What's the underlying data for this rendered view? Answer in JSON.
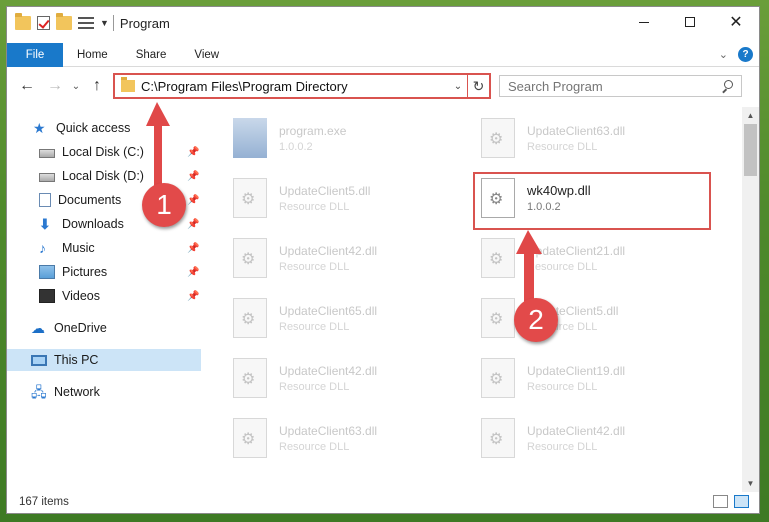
{
  "window": {
    "title": "Program",
    "status": "167 items"
  },
  "ribbon": {
    "tabs": [
      "File",
      "Home",
      "Share",
      "View"
    ]
  },
  "address": {
    "path": "C:\\Program Files\\Program Directory"
  },
  "search": {
    "placeholder": "Search Program"
  },
  "sidebar": {
    "items": [
      {
        "label": "Quick access",
        "icon": "star-icon"
      },
      {
        "label": "Local Disk (C:)",
        "icon": "drive-icon"
      },
      {
        "label": "Local Disk (D:)",
        "icon": "drive-icon"
      },
      {
        "label": "Documents",
        "icon": "documents-icon"
      },
      {
        "label": "Downloads",
        "icon": "download-icon"
      },
      {
        "label": "Music",
        "icon": "music-icon"
      },
      {
        "label": "Pictures",
        "icon": "pictures-icon"
      },
      {
        "label": "Videos",
        "icon": "videos-icon"
      },
      {
        "label": "OneDrive",
        "icon": "cloud-icon"
      },
      {
        "label": "This PC",
        "icon": "computer-icon"
      },
      {
        "label": "Network",
        "icon": "network-icon"
      }
    ]
  },
  "files": {
    "col1": [
      {
        "name": "program.exe",
        "sub": "1.0.0.2"
      },
      {
        "name": "UpdateClient5.dll",
        "sub": "Resource DLL"
      },
      {
        "name": "UpdateClient42.dll",
        "sub": "Resource DLL"
      },
      {
        "name": "UpdateClient65.dll",
        "sub": "Resource DLL"
      },
      {
        "name": "UpdateClient42.dll",
        "sub": "Resource DLL"
      },
      {
        "name": "UpdateClient63.dll",
        "sub": "Resource DLL"
      }
    ],
    "col2": [
      {
        "name": "UpdateClient63.dll",
        "sub": "Resource DLL"
      },
      {
        "name": "wk40wp.dll",
        "sub": "1.0.0.2"
      },
      {
        "name": "UpdateClient21.dll",
        "sub": "Resource DLL"
      },
      {
        "name": "UpdateClient5.dll",
        "sub": "Resource DLL"
      },
      {
        "name": "UpdateClient19.dll",
        "sub": "Resource DLL"
      },
      {
        "name": "UpdateClient42.dll",
        "sub": "Resource DLL"
      }
    ]
  },
  "annotations": {
    "step1": "1",
    "step2": "2"
  },
  "colors": {
    "accent": "#1979ca",
    "annotation": "#e24a4a"
  }
}
